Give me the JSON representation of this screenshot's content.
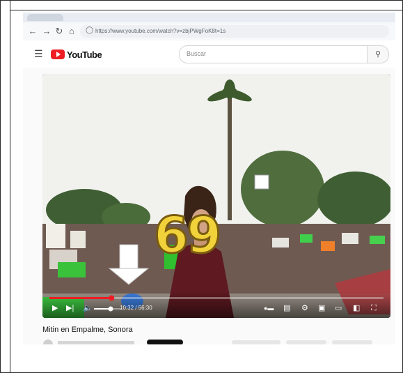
{
  "browser": {
    "url": "https://www.youtube.com/watch?v=zbjPWgFoK8t=1s"
  },
  "youtube": {
    "logo_text": "YouTube",
    "search_placeholder": "Buscar"
  },
  "player": {
    "timecode": "10:32 / 56:30",
    "progress_fraction": 0.186,
    "volume_fraction": 0.6,
    "overlay_number": "69"
  },
  "video": {
    "title": "Mitin en Empalme, Sonora"
  },
  "icons": {
    "back": "arrow-left-icon",
    "forward": "arrow-right-icon",
    "reload": "reload-icon",
    "home": "home-icon",
    "menu": "hamburger-menu-icon",
    "search": "search-icon",
    "play": "play-icon",
    "next": "next-icon",
    "volume": "volume-icon",
    "autoplay": "autoplay-toggle-icon",
    "subtitles": "subtitles-icon",
    "settings": "gear-icon",
    "miniplayer": "miniplayer-icon",
    "theater": "theater-mode-icon",
    "cast": "cast-icon",
    "fullscreen": "fullscreen-icon"
  },
  "colors": {
    "youtube_red": "#ee1d23",
    "progress_red": "#ee1d23",
    "overlay_number": "#f2d23a",
    "arrow": "#ffffff",
    "dot": "#3b7ddd"
  }
}
